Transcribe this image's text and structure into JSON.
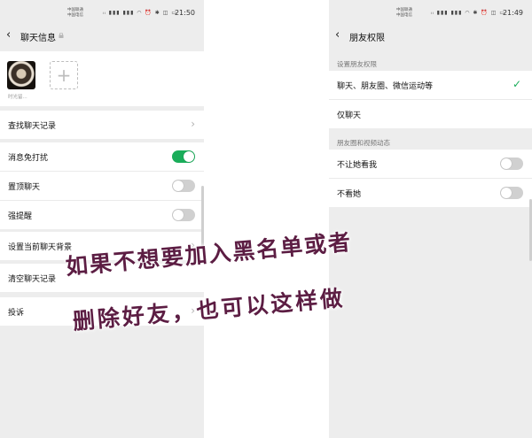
{
  "left_screen": {
    "status": {
      "carrier_1": "中国联通",
      "carrier_2": "中国电信",
      "time": "21:50",
      "icons": "ᵢᵢ ▮▮▮ ▮▮▮ ◠ ⏰ ✱ ◫ ▭"
    },
    "nav": {
      "title": "聊天信息"
    },
    "member": {
      "name": "时光留..."
    },
    "rows": {
      "search_history": "查找聊天记录",
      "mute": "消息免打扰",
      "pin": "置顶聊天",
      "reminder": "强提醒",
      "set_background": "设置当前聊天背景",
      "clear_history": "清空聊天记录",
      "report": "投诉"
    },
    "toggles": {
      "mute": true,
      "pin": false,
      "reminder": false
    }
  },
  "right_screen": {
    "status": {
      "carrier_1": "中国联通",
      "carrier_2": "中国电信",
      "time": "21:49",
      "icons": "ᵢᵢ ▮▮▮ ▮▮▮ ◠ ✱ ⏰ ◫ ▭"
    },
    "nav": {
      "title": "朋友权限"
    },
    "section_permissions": "设置朋友权限",
    "options": {
      "full_access": "聊天、朋友圈、微信运动等",
      "chat_only": "仅聊天"
    },
    "selected_option": "full_access",
    "section_moments": "朋友圈和视频动态",
    "moments_rows": {
      "hide_mine": "不让她看我",
      "hide_theirs": "不看她"
    },
    "moments_toggles": {
      "hide_mine": false,
      "hide_theirs": false
    }
  },
  "overlay": {
    "line_1": "如果不想要加入黑名单或者",
    "line_2": "删除好友，也可以这样做"
  },
  "colors": {
    "accent_green": "#1aad5a",
    "overlay_text": "#5c1d43",
    "background_gray": "#ededed"
  },
  "icons": [
    "back-icon",
    "lock-icon",
    "chevron-right-icon",
    "plus-icon",
    "checkmark-icon",
    "toggle-switch"
  ]
}
